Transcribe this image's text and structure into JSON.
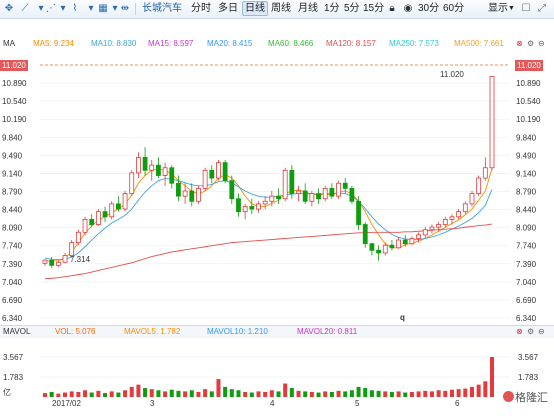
{
  "toolbar": {
    "stock_name": "长城汽车",
    "tabs": [
      "分时",
      "多日",
      "日线",
      "周线",
      "月线",
      "1分",
      "5分",
      "15分",
      "30分",
      "60分"
    ],
    "active_tab": "日线",
    "display_label": "显示",
    "display_arrow": "▼"
  },
  "ma_legend": {
    "label": "MA",
    "items": [
      {
        "text": "MA5: 9.234",
        "color": "#ff8c00"
      },
      {
        "text": "MA10: 8.830",
        "color": "#3da5d9"
      },
      {
        "text": "MA15: 8.597",
        "color": "#cc33cc"
      },
      {
        "text": "MA20: 8.415",
        "color": "#3399ff"
      },
      {
        "text": "MA60: 8.466",
        "color": "#33bb33"
      },
      {
        "text": "MA120: 8.157",
        "color": "#e34d4d"
      },
      {
        "text": "MA250: 7.573",
        "color": "#33cccc"
      },
      {
        "text": "MA500: 7.661",
        "color": "#f0a030"
      }
    ]
  },
  "price_axis": {
    "ticks": [
      "10.890",
      "10.540",
      "10.190",
      "9.840",
      "9.490",
      "9.140",
      "8.790",
      "8.440",
      "8.090",
      "7.740",
      "7.390",
      "7.040",
      "6.690",
      "6.340"
    ],
    "current_price": "11.020",
    "max_label": "11.020",
    "min_label": "7.314",
    "q_label": "q"
  },
  "volume_legend": {
    "label": "MAVOL",
    "items": [
      {
        "text": "VOL: 5.076",
        "color": "#ff6600"
      },
      {
        "text": "MAVOL5: 1.782",
        "color": "#ff8c00"
      },
      {
        "text": "MAVOL10: 1.210",
        "color": "#3399ff"
      },
      {
        "text": "MAVOL20: 0.811",
        "color": "#cc33cc"
      }
    ]
  },
  "volume_axis": {
    "ticks": [
      "3.567",
      "1.783"
    ],
    "unit": "亿"
  },
  "date_axis": [
    "2017/02",
    "3",
    "4",
    "5",
    "6"
  ],
  "watermark": "格隆汇",
  "colors": {
    "up": "#e33b3b",
    "down": "#0f9d0f",
    "accent": "#1f5fa8"
  },
  "chart_data": {
    "type": "candlestick",
    "ylim": [
      6.34,
      11.24
    ],
    "candles": [
      [
        7.4,
        7.48,
        7.35,
        7.46
      ],
      [
        7.46,
        7.52,
        7.31,
        7.36
      ],
      [
        7.36,
        7.45,
        7.32,
        7.42
      ],
      [
        7.42,
        7.6,
        7.4,
        7.55
      ],
      [
        7.55,
        7.85,
        7.52,
        7.8
      ],
      [
        7.8,
        8.05,
        7.75,
        8.0
      ],
      [
        8.0,
        8.3,
        7.95,
        8.25
      ],
      [
        8.25,
        8.35,
        8.1,
        8.15
      ],
      [
        8.15,
        8.45,
        8.12,
        8.4
      ],
      [
        8.4,
        8.5,
        8.2,
        8.3
      ],
      [
        8.3,
        8.6,
        8.25,
        8.55
      ],
      [
        8.55,
        8.7,
        8.4,
        8.45
      ],
      [
        8.45,
        8.8,
        8.4,
        8.75
      ],
      [
        8.75,
        9.2,
        8.7,
        9.15
      ],
      [
        9.15,
        9.55,
        9.05,
        9.45
      ],
      [
        9.45,
        9.65,
        9.1,
        9.2
      ],
      [
        9.2,
        9.4,
        9.0,
        9.3
      ],
      [
        9.3,
        9.45,
        9.05,
        9.1
      ],
      [
        9.1,
        9.35,
        8.9,
        9.25
      ],
      [
        9.25,
        9.3,
        8.85,
        8.95
      ],
      [
        8.95,
        9.1,
        8.6,
        8.7
      ],
      [
        8.7,
        8.95,
        8.55,
        8.8
      ],
      [
        8.8,
        8.95,
        8.5,
        8.6
      ],
      [
        8.6,
        8.9,
        8.55,
        8.85
      ],
      [
        8.85,
        9.25,
        8.8,
        9.2
      ],
      [
        9.2,
        9.3,
        8.95,
        9.05
      ],
      [
        9.05,
        9.4,
        9.0,
        9.35
      ],
      [
        9.35,
        9.4,
        8.95,
        9.0
      ],
      [
        9.0,
        9.1,
        8.55,
        8.65
      ],
      [
        8.65,
        8.75,
        8.3,
        8.4
      ],
      [
        8.4,
        8.55,
        8.25,
        8.5
      ],
      [
        8.5,
        8.65,
        8.35,
        8.45
      ],
      [
        8.45,
        8.6,
        8.38,
        8.55
      ],
      [
        8.55,
        8.7,
        8.45,
        8.6
      ],
      [
        8.6,
        8.8,
        8.5,
        8.7
      ],
      [
        8.7,
        8.85,
        8.55,
        8.65
      ],
      [
        8.65,
        9.25,
        8.6,
        9.2
      ],
      [
        9.2,
        9.3,
        8.65,
        8.75
      ],
      [
        8.75,
        8.9,
        8.6,
        8.8
      ],
      [
        8.8,
        8.95,
        8.55,
        8.6
      ],
      [
        8.6,
        8.8,
        8.5,
        8.75
      ],
      [
        8.75,
        8.85,
        8.55,
        8.65
      ],
      [
        8.65,
        8.9,
        8.6,
        8.85
      ],
      [
        8.85,
        8.95,
        8.65,
        8.7
      ],
      [
        8.7,
        9.0,
        8.65,
        8.95
      ],
      [
        8.95,
        9.05,
        8.75,
        8.85
      ],
      [
        8.85,
        8.9,
        8.55,
        8.6
      ],
      [
        8.6,
        8.7,
        8.05,
        8.15
      ],
      [
        8.15,
        8.2,
        7.7,
        7.78
      ],
      [
        7.78,
        7.8,
        7.55,
        7.65
      ],
      [
        7.65,
        7.75,
        7.45,
        7.6
      ],
      [
        7.6,
        7.8,
        7.55,
        7.75
      ],
      [
        7.75,
        7.85,
        7.65,
        7.7
      ],
      [
        7.7,
        7.9,
        7.68,
        7.85
      ],
      [
        7.85,
        7.95,
        7.72,
        7.78
      ],
      [
        7.78,
        7.92,
        7.75,
        7.88
      ],
      [
        7.88,
        8.0,
        7.8,
        7.95
      ],
      [
        7.95,
        8.1,
        7.88,
        8.05
      ],
      [
        8.05,
        8.15,
        7.98,
        8.1
      ],
      [
        8.1,
        8.2,
        8.02,
        8.15
      ],
      [
        8.15,
        8.3,
        8.1,
        8.25
      ],
      [
        8.25,
        8.35,
        8.15,
        8.3
      ],
      [
        8.3,
        8.45,
        8.25,
        8.4
      ],
      [
        8.4,
        8.6,
        8.35,
        8.55
      ],
      [
        8.55,
        8.8,
        8.5,
        8.75
      ],
      [
        8.75,
        9.1,
        8.7,
        9.05
      ],
      [
        9.05,
        9.45,
        9.0,
        9.25
      ],
      [
        9.25,
        11.02,
        9.2,
        11.02
      ]
    ],
    "volumes": [
      0.35,
      0.45,
      0.3,
      0.4,
      0.5,
      0.45,
      0.6,
      0.4,
      0.55,
      0.35,
      0.5,
      0.4,
      0.6,
      0.9,
      1.1,
      0.8,
      0.7,
      0.6,
      0.5,
      0.65,
      0.55,
      0.5,
      0.6,
      0.45,
      0.7,
      0.5,
      1.6,
      0.9,
      0.7,
      0.6,
      0.45,
      0.4,
      0.5,
      0.45,
      0.6,
      0.5,
      1.2,
      0.8,
      0.55,
      0.5,
      0.45,
      0.4,
      0.5,
      0.45,
      0.55,
      0.5,
      0.6,
      0.9,
      0.8,
      0.6,
      0.55,
      0.5,
      0.45,
      0.5,
      0.4,
      0.45,
      0.5,
      0.55,
      0.5,
      0.6,
      0.55,
      0.65,
      0.7,
      0.75,
      0.9,
      1.1,
      1.4,
      3.567
    ],
    "ma_lines": [
      {
        "name": "MA5",
        "color": "#ff8c00",
        "values": [
          7.45,
          7.44,
          7.45,
          7.5,
          7.62,
          7.8,
          7.98,
          8.12,
          8.24,
          8.3,
          8.38,
          8.45,
          8.55,
          8.72,
          8.95,
          9.1,
          9.2,
          9.22,
          9.2,
          9.13,
          9.0,
          8.9,
          8.8,
          8.74,
          8.8,
          8.9,
          9.05,
          9.12,
          9.05,
          8.9,
          8.7,
          8.55,
          8.5,
          8.5,
          8.56,
          8.62,
          8.75,
          8.8,
          8.82,
          8.78,
          8.74,
          8.72,
          8.74,
          8.72,
          8.78,
          8.8,
          8.75,
          8.6,
          8.4,
          8.15,
          7.95,
          7.78,
          7.7,
          7.7,
          7.76,
          7.79,
          7.83,
          7.88,
          7.95,
          8.02,
          8.1,
          8.17,
          8.24,
          8.34,
          8.45,
          8.62,
          8.8,
          9.23
        ]
      },
      {
        "name": "MA10",
        "color": "#3da5d9",
        "values": [
          7.5,
          7.48,
          7.47,
          7.48,
          7.52,
          7.6,
          7.72,
          7.85,
          7.97,
          8.08,
          8.18,
          8.25,
          8.33,
          8.45,
          8.62,
          8.78,
          8.9,
          9.0,
          9.04,
          9.03,
          9.0,
          8.96,
          8.92,
          8.9,
          8.9,
          8.93,
          8.98,
          9.0,
          8.96,
          8.88,
          8.8,
          8.74,
          8.7,
          8.68,
          8.68,
          8.7,
          8.72,
          8.74,
          8.75,
          8.75,
          8.74,
          8.74,
          8.75,
          8.75,
          8.76,
          8.75,
          8.7,
          8.6,
          8.46,
          8.3,
          8.16,
          8.05,
          7.96,
          7.9,
          7.87,
          7.86,
          7.86,
          7.88,
          7.91,
          7.95,
          8.0,
          8.06,
          8.12,
          8.19,
          8.27,
          8.38,
          8.52,
          8.83
        ]
      },
      {
        "name": "MA120",
        "color": "#e34d4d",
        "values": [
          7.1,
          7.11,
          7.12,
          7.14,
          7.16,
          7.18,
          7.2,
          7.23,
          7.26,
          7.29,
          7.32,
          7.35,
          7.38,
          7.41,
          7.45,
          7.49,
          7.53,
          7.56,
          7.59,
          7.62,
          7.64,
          7.66,
          7.68,
          7.7,
          7.72,
          7.74,
          7.76,
          7.78,
          7.8,
          7.81,
          7.82,
          7.83,
          7.84,
          7.85,
          7.86,
          7.87,
          7.88,
          7.89,
          7.9,
          7.91,
          7.92,
          7.93,
          7.94,
          7.95,
          7.96,
          7.97,
          7.98,
          7.99,
          7.99,
          8.0,
          8.0,
          8.0,
          8.0,
          8.0,
          8.01,
          8.01,
          8.02,
          8.03,
          8.04,
          8.05,
          8.06,
          8.07,
          8.08,
          8.1,
          8.11,
          8.13,
          8.14,
          8.16
        ]
      }
    ]
  }
}
